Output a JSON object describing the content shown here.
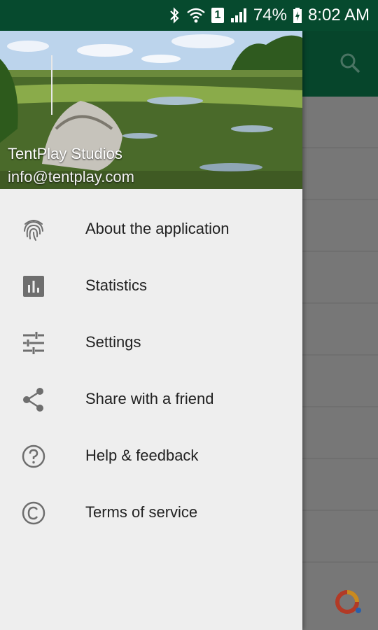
{
  "status_bar": {
    "battery": "74%",
    "time": "8:02 AM",
    "sim_slot": "1"
  },
  "drawer": {
    "header": {
      "name": "TentPlay Studios",
      "email": "info@tentplay.com"
    },
    "items": [
      {
        "label": "About the application",
        "icon": "fingerprint-icon"
      },
      {
        "label": "Statistics",
        "icon": "bar-chart-icon"
      },
      {
        "label": "Settings",
        "icon": "tune-sliders-icon"
      },
      {
        "label": "Share with a friend",
        "icon": "share-icon"
      },
      {
        "label": "Help & feedback",
        "icon": "help-circle-icon"
      },
      {
        "label": "Terms of service",
        "icon": "copyright-icon"
      }
    ]
  },
  "colors": {
    "status_bar": "#064a2e",
    "toolbar": "#06452b",
    "drawer_bg": "#eeeeee",
    "icon_gray": "#6e6e6e"
  }
}
